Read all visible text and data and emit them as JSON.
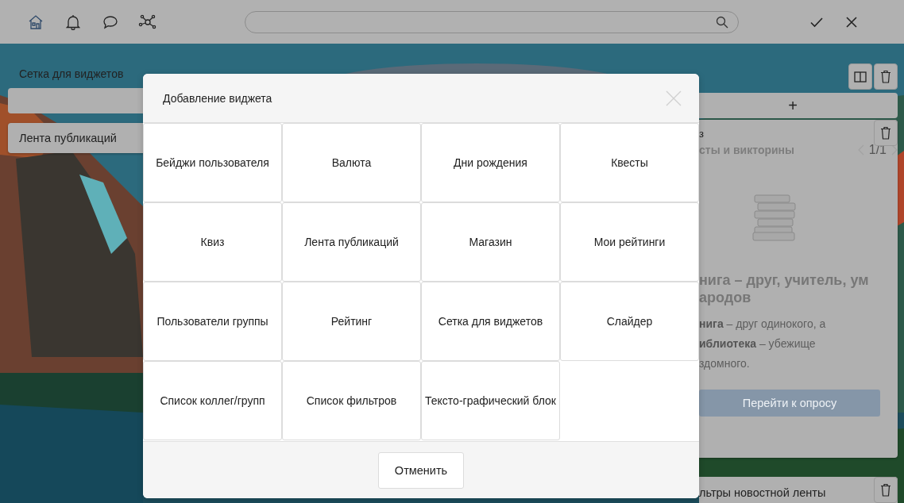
{
  "left": {
    "title": "Сетка для виджетов",
    "items": [
      "Лента публикаций"
    ]
  },
  "right": {
    "add_label": "+",
    "quiz": {
      "type_label": "з",
      "title": "сты и викторины",
      "pager": "1/1",
      "heading_lines": [
        "нига – друг, учитель, ум",
        "ародов"
      ],
      "quote_lines": [
        "**нига** – друг одинокого, а",
        "**иблиотека** – убежище",
        "здомного."
      ],
      "button": "Перейти к опросу"
    },
    "filters": {
      "title": "льтры новостной ленты"
    }
  },
  "dialog": {
    "title": "Добавление виджета",
    "widgets": [
      "Бейджи пользователя",
      "Валюта",
      "Дни рождения",
      "Квесты",
      "Квиз",
      "Лента публикаций",
      "Магазин",
      "Мои рейтинги",
      "Пользователи группы",
      "Рейтинг",
      "Сетка для виджетов",
      "Слайдер",
      "Список коллег/групп",
      "Список фильтров",
      "Тексто-графический блок"
    ],
    "cancel": "Отменить"
  }
}
